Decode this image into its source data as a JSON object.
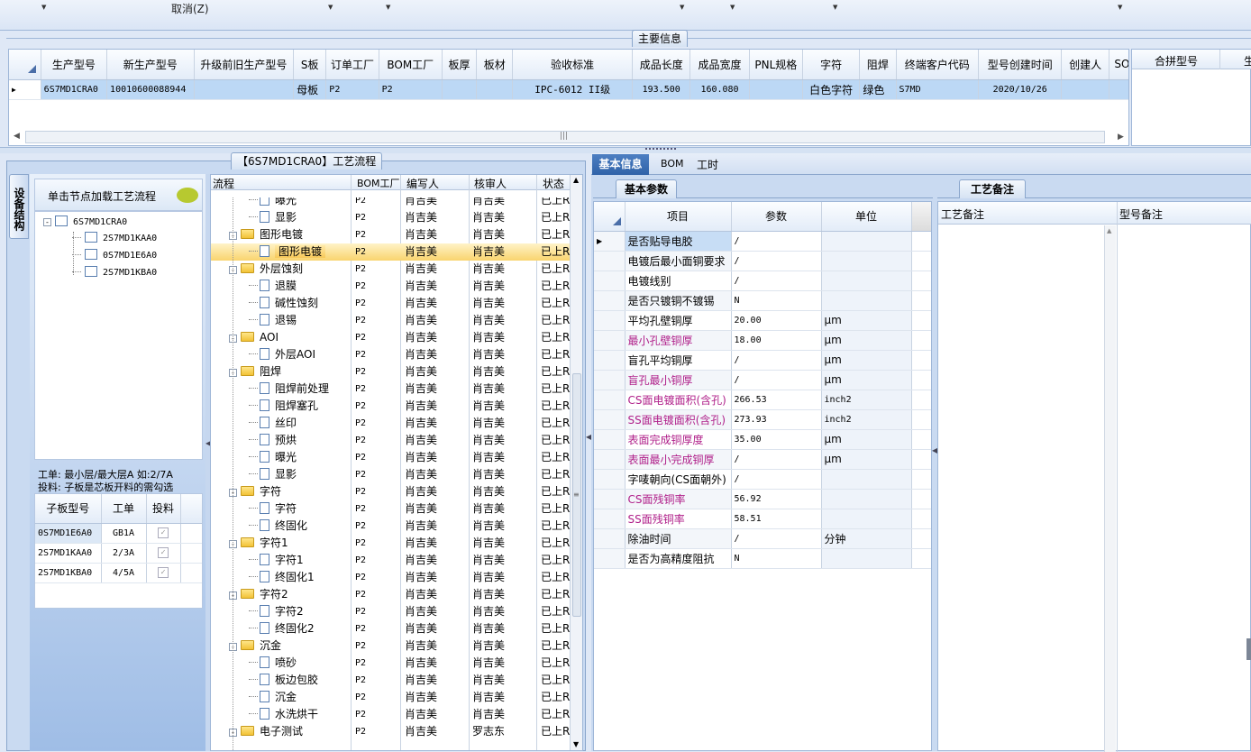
{
  "toolbar": {
    "cancel_label": "取消(Z)"
  },
  "main_info": {
    "section_title": "主要信息",
    "columns": [
      "生产型号",
      "新生产型号",
      "升级前旧生产型号",
      "S板",
      "订单工厂",
      "BOM工厂",
      "板厚",
      "板材",
      "验收标准",
      "成品长度",
      "成品宽度",
      "PNL规格",
      "字符",
      "阻焊",
      "终端客户代码",
      "型号创建时间",
      "创建人",
      "SO"
    ],
    "row": [
      "6S7MD1CRA0",
      "10010600088944",
      "",
      "母板",
      "P2",
      "P2",
      "",
      "",
      "IPC-6012 II级",
      "193.500",
      "160.080",
      "",
      "白色字符",
      "绿色",
      "S7MD",
      "2020/10/26",
      "",
      ""
    ],
    "merge_columns": [
      "合拼型号",
      "生"
    ]
  },
  "process_panel": {
    "title": "【6S7MD1CRA0】工艺流程",
    "side_tab": "设备结构",
    "load_hint": "单击节点加载工艺流程",
    "tree_root": "6S7MD1CRA0",
    "tree_children": [
      "2S7MD1KAA0",
      "0S7MD1E6A0",
      "2S7MD1KBA0"
    ],
    "note1": "工单: 最小层/最大层A 如:2/7A",
    "note2": "投料: 子板是芯板开料的需勾选",
    "sub_columns": [
      "子板型号",
      "工单",
      "投料"
    ],
    "sub_rows": [
      {
        "model": "0S7MD1E6A0",
        "order": "GB1A"
      },
      {
        "model": "2S7MD1KAA0",
        "order": "2/3A"
      },
      {
        "model": "2S7MD1KBA0",
        "order": "4/5A"
      }
    ],
    "flow_columns": [
      "流程",
      "BOM工厂",
      "编写人",
      "核审人",
      "状态"
    ],
    "flow_rows": [
      {
        "name": "曝光",
        "kind": "leaf",
        "f": "P2",
        "w": "肖吉美",
        "r": "肖吉美",
        "s": "已上R"
      },
      {
        "name": "显影",
        "kind": "leaf",
        "f": "P2",
        "w": "肖吉美",
        "r": "肖吉美",
        "s": "已上R"
      },
      {
        "name": "图形电镀",
        "kind": "folder",
        "f": "P2",
        "w": "肖吉美",
        "r": "肖吉美",
        "s": "已上R"
      },
      {
        "name": "图形电镀",
        "kind": "leaf-sel",
        "f": "P2",
        "w": "肖吉美",
        "r": "肖吉美",
        "s": "已上R"
      },
      {
        "name": "外层蚀刻",
        "kind": "folder",
        "f": "P2",
        "w": "肖吉美",
        "r": "肖吉美",
        "s": "已上R"
      },
      {
        "name": "退膜",
        "kind": "leaf",
        "f": "P2",
        "w": "肖吉美",
        "r": "肖吉美",
        "s": "已上R"
      },
      {
        "name": "碱性蚀刻",
        "kind": "leaf",
        "f": "P2",
        "w": "肖吉美",
        "r": "肖吉美",
        "s": "已上R"
      },
      {
        "name": "退锡",
        "kind": "leaf",
        "f": "P2",
        "w": "肖吉美",
        "r": "肖吉美",
        "s": "已上R"
      },
      {
        "name": "AOI",
        "kind": "folder",
        "f": "P2",
        "w": "肖吉美",
        "r": "肖吉美",
        "s": "已上R"
      },
      {
        "name": "外层AOI",
        "kind": "leaf",
        "f": "P2",
        "w": "肖吉美",
        "r": "肖吉美",
        "s": "已上R"
      },
      {
        "name": "阻焊",
        "kind": "folder",
        "f": "P2",
        "w": "肖吉美",
        "r": "肖吉美",
        "s": "已上R"
      },
      {
        "name": "阻焊前处理",
        "kind": "leaf",
        "f": "P2",
        "w": "肖吉美",
        "r": "肖吉美",
        "s": "已上R"
      },
      {
        "name": "阻焊塞孔",
        "kind": "leaf",
        "f": "P2",
        "w": "肖吉美",
        "r": "肖吉美",
        "s": "已上R"
      },
      {
        "name": "丝印",
        "kind": "leaf",
        "f": "P2",
        "w": "肖吉美",
        "r": "肖吉美",
        "s": "已上R"
      },
      {
        "name": "预烘",
        "kind": "leaf",
        "f": "P2",
        "w": "肖吉美",
        "r": "肖吉美",
        "s": "已上R"
      },
      {
        "name": "曝光",
        "kind": "leaf",
        "f": "P2",
        "w": "肖吉美",
        "r": "肖吉美",
        "s": "已上R"
      },
      {
        "name": "显影",
        "kind": "leaf",
        "f": "P2",
        "w": "肖吉美",
        "r": "肖吉美",
        "s": "已上R"
      },
      {
        "name": "字符",
        "kind": "folder",
        "f": "P2",
        "w": "肖吉美",
        "r": "肖吉美",
        "s": "已上R"
      },
      {
        "name": "字符",
        "kind": "leaf",
        "f": "P2",
        "w": "肖吉美",
        "r": "肖吉美",
        "s": "已上R"
      },
      {
        "name": "终固化",
        "kind": "leaf",
        "f": "P2",
        "w": "肖吉美",
        "r": "肖吉美",
        "s": "已上R"
      },
      {
        "name": "字符1",
        "kind": "folder",
        "f": "P2",
        "w": "肖吉美",
        "r": "肖吉美",
        "s": "已上R"
      },
      {
        "name": "字符1",
        "kind": "leaf",
        "f": "P2",
        "w": "肖吉美",
        "r": "肖吉美",
        "s": "已上R"
      },
      {
        "name": "终固化1",
        "kind": "leaf",
        "f": "P2",
        "w": "肖吉美",
        "r": "肖吉美",
        "s": "已上R"
      },
      {
        "name": "字符2",
        "kind": "folder",
        "f": "P2",
        "w": "肖吉美",
        "r": "肖吉美",
        "s": "已上R"
      },
      {
        "name": "字符2",
        "kind": "leaf",
        "f": "P2",
        "w": "肖吉美",
        "r": "肖吉美",
        "s": "已上R"
      },
      {
        "name": "终固化2",
        "kind": "leaf",
        "f": "P2",
        "w": "肖吉美",
        "r": "肖吉美",
        "s": "已上R"
      },
      {
        "name": "沉金",
        "kind": "folder",
        "f": "P2",
        "w": "肖吉美",
        "r": "肖吉美",
        "s": "已上R"
      },
      {
        "name": "喷砂",
        "kind": "leaf",
        "f": "P2",
        "w": "肖吉美",
        "r": "肖吉美",
        "s": "已上R"
      },
      {
        "name": "板边包胶",
        "kind": "leaf",
        "f": "P2",
        "w": "肖吉美",
        "r": "肖吉美",
        "s": "已上R"
      },
      {
        "name": "沉金",
        "kind": "leaf",
        "f": "P2",
        "w": "肖吉美",
        "r": "肖吉美",
        "s": "已上R"
      },
      {
        "name": "水洗烘干",
        "kind": "leaf",
        "f": "P2",
        "w": "肖吉美",
        "r": "肖吉美",
        "s": "已上R"
      },
      {
        "name": "电子测试",
        "kind": "folder",
        "f": "P2",
        "w": "肖吉美",
        "r": "罗志东",
        "s": "已上R"
      }
    ]
  },
  "detail_tabs": [
    "基本信息",
    "BOM",
    "工时"
  ],
  "params": {
    "subtab": "基本参数",
    "columns": [
      "项目",
      "参数",
      "单位"
    ],
    "rows": [
      {
        "item": "是否贴导电胶",
        "value": "/",
        "unit": "",
        "pink": false
      },
      {
        "item": "电镀后最小面铜要求",
        "value": "/",
        "unit": "",
        "pink": false
      },
      {
        "item": "电镀线别",
        "value": "/",
        "unit": "",
        "pink": false
      },
      {
        "item": "是否只镀铜不镀锡",
        "value": "N",
        "unit": "",
        "pink": false
      },
      {
        "item": "平均孔壁铜厚",
        "value": "20.00",
        "unit": "μm",
        "pink": false
      },
      {
        "item": "最小孔壁铜厚",
        "value": "18.00",
        "unit": "μm",
        "pink": true
      },
      {
        "item": "盲孔平均铜厚",
        "value": "/",
        "unit": "μm",
        "pink": false
      },
      {
        "item": "盲孔最小铜厚",
        "value": "/",
        "unit": "μm",
        "pink": true
      },
      {
        "item": "CS面电镀面积(含孔)",
        "value": "266.53",
        "unit": "inch2",
        "pink": true
      },
      {
        "item": "SS面电镀面积(含孔)",
        "value": "273.93",
        "unit": "inch2",
        "pink": true
      },
      {
        "item": "表面完成铜厚度",
        "value": "35.00",
        "unit": "μm",
        "pink": true
      },
      {
        "item": "表面最小完成铜厚",
        "value": "/",
        "unit": "μm",
        "pink": true
      },
      {
        "item": "字唛朝向(CS面朝外)",
        "value": "/",
        "unit": "",
        "pink": false
      },
      {
        "item": "CS面残铜率",
        "value": "56.92",
        "unit": "",
        "pink": true
      },
      {
        "item": "SS面残铜率",
        "value": "58.51",
        "unit": "",
        "pink": true
      },
      {
        "item": "除油时间",
        "value": "/",
        "unit": "分钟",
        "pink": false
      },
      {
        "item": "是否为高精度阻抗",
        "value": "N",
        "unit": "",
        "pink": false
      }
    ]
  },
  "notes": {
    "tab": "工艺备注",
    "col1": "工艺备注",
    "col2": "型号备注"
  }
}
